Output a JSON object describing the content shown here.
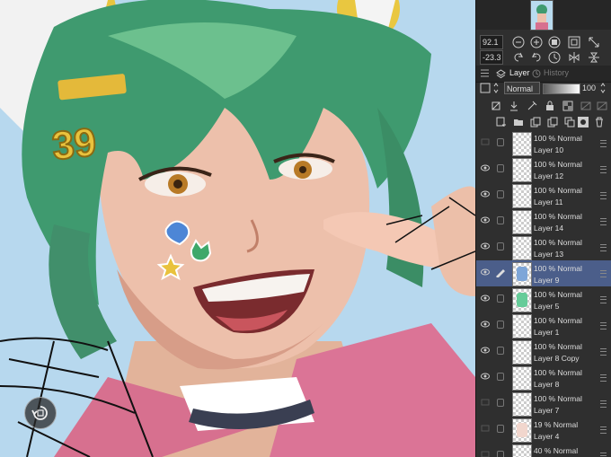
{
  "canvas": {
    "badge_text": "39"
  },
  "navigator": {
    "zoom_value": "92.1",
    "angle_value": "-23.3"
  },
  "tabs": {
    "layer_label": "Layer",
    "history_label": "History"
  },
  "layer_properties": {
    "blend_mode": "Normal",
    "opacity_value": "100"
  },
  "layers": [
    {
      "mode": "100 % Normal",
      "name": "Layer 10",
      "visible": false,
      "selected": false
    },
    {
      "mode": "100 % Normal",
      "name": "Layer 12",
      "visible": true,
      "selected": false
    },
    {
      "mode": "100 % Normal",
      "name": "Layer 11",
      "visible": true,
      "selected": false
    },
    {
      "mode": "100 % Normal",
      "name": "Layer 14",
      "visible": true,
      "selected": false
    },
    {
      "mode": "100 % Normal",
      "name": "Layer 13",
      "visible": true,
      "selected": false
    },
    {
      "mode": "100 % Normal",
      "name": "Layer 9",
      "visible": true,
      "selected": true
    },
    {
      "mode": "100 % Normal",
      "name": "Layer 5",
      "visible": true,
      "selected": false
    },
    {
      "mode": "100 % Normal",
      "name": "Layer 1",
      "visible": true,
      "selected": false
    },
    {
      "mode": "100 % Normal",
      "name": "Layer 8 Copy",
      "visible": true,
      "selected": false
    },
    {
      "mode": "100 % Normal",
      "name": "Layer 8",
      "visible": true,
      "selected": false
    },
    {
      "mode": "100 % Normal",
      "name": "Layer 7",
      "visible": false,
      "selected": false
    },
    {
      "mode": "19 % Normal",
      "name": "Layer 4",
      "visible": false,
      "selected": false
    },
    {
      "mode": "40 % Normal",
      "name": "",
      "visible": false,
      "selected": false
    }
  ],
  "colors": {
    "selected_layer": "#4b5e8a",
    "panel_bg": "#2f2f2f",
    "canvas_bg": "#b7d8ee"
  }
}
